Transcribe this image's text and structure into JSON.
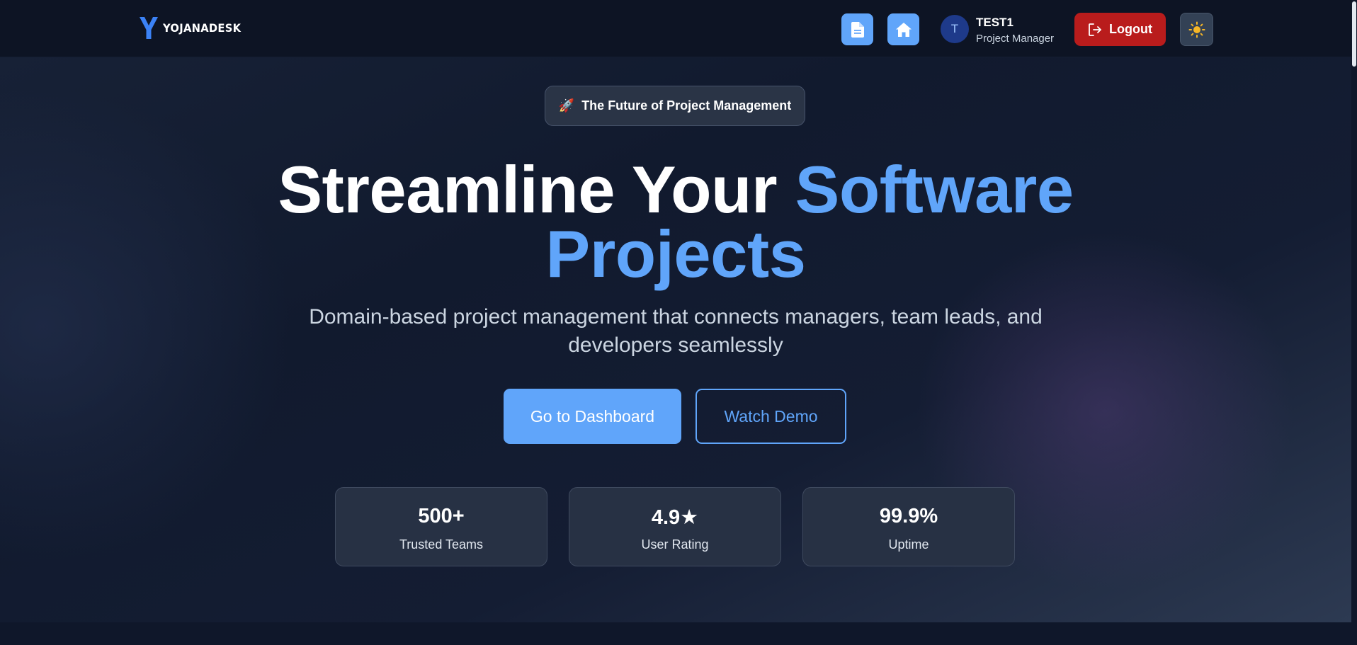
{
  "header": {
    "brand": "YOJANADESK",
    "user": {
      "initial": "T",
      "name": "TEST1",
      "role": "Project Manager"
    },
    "logout_label": "Logout"
  },
  "hero": {
    "badge": {
      "icon": "rocket-icon",
      "emoji": "🚀",
      "label": "The Future of Project Management"
    },
    "headline": {
      "line1_plain": "Streamline Your ",
      "line1_accent": "Software",
      "line2_accent": "Projects"
    },
    "subtitle": "Domain-based project management that connects managers, team leads, and developers seamlessly",
    "primary_button": "Go to Dashboard",
    "secondary_button": "Watch Demo"
  },
  "stats": [
    {
      "value": "500+",
      "label": "Trusted Teams"
    },
    {
      "value": "4.9★",
      "label": "User Rating"
    },
    {
      "value": "99.9%",
      "label": "Uptime"
    }
  ],
  "colors": {
    "background": "#0e1526",
    "navbar": "#0d1424",
    "accent": "#60a5fa",
    "danger": "#b91c1c",
    "card": "#273144",
    "sun": "#f6b626"
  },
  "icons": [
    "document-icon",
    "home-icon",
    "logout-icon",
    "sun-icon",
    "rocket-icon"
  ]
}
